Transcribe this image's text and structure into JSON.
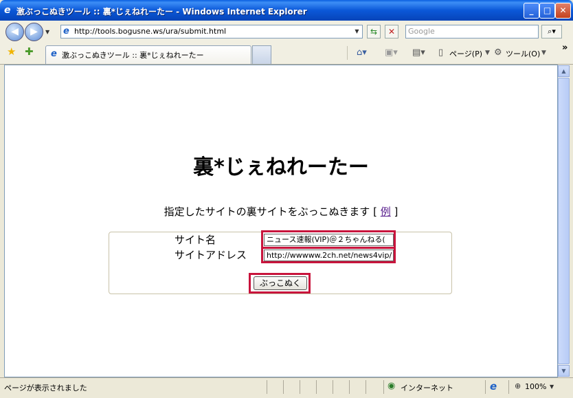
{
  "window": {
    "title": "激ぶっこぬきツール :: 裏*じぇねれーたー - Windows Internet Explorer",
    "minimize": "_",
    "maximize": "□",
    "close": "✕"
  },
  "addressbar": {
    "url": "http://tools.bogusne.ws/ura/submit.html",
    "search_placeholder": "Google"
  },
  "tabs": [
    {
      "label": "激ぶっこぬきツール :: 裏*じぇねれーたー"
    }
  ],
  "toolbar": {
    "page_label": "ページ(P)",
    "tools_label": "ツール(O)",
    "more": "»"
  },
  "page": {
    "heading": "裏*じぇねれーたー",
    "description": "指定したサイトの裏サイトをぶっこぬきます",
    "bracket_open": "[",
    "example_link": "例",
    "bracket_close": "]",
    "form": {
      "site_name_label": "サイト名",
      "site_name_value": "ニュース速報(VIP)＠２ちゃんねる(",
      "site_address_label": "サイトアドレス",
      "site_address_value": "http://wwwww.2ch.net/news4vip/",
      "submit_label": "ぶっこぬく"
    }
  },
  "status": {
    "text": "ページが表示されました",
    "zone": "インターネット",
    "zoom": "100%"
  },
  "colors": {
    "highlight": "#c8143c",
    "titlebar": "#0b58d8",
    "link": "#551a8b"
  },
  "icons": [
    "ie-icon",
    "back-icon",
    "forward-icon",
    "refresh-icon",
    "stop-icon",
    "search-icon",
    "favorites-star-icon",
    "add-favorites-icon",
    "home-icon",
    "feeds-icon",
    "print-icon",
    "page-icon",
    "tools-gear-icon",
    "globe-icon",
    "zoom-icon"
  ]
}
